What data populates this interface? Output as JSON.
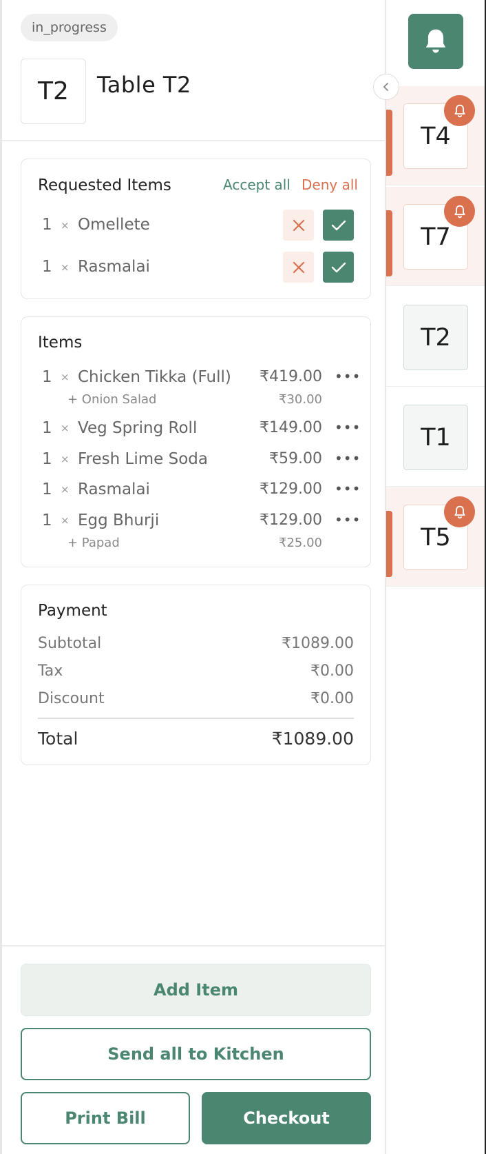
{
  "order": {
    "status": "in_progress",
    "table_code": "T2",
    "table_title": "Table T2"
  },
  "requested": {
    "title": "Requested Items",
    "accept_all": "Accept all",
    "deny_all": "Deny all",
    "items": [
      {
        "qty": "1",
        "times": "×",
        "name": "Omellete"
      },
      {
        "qty": "1",
        "times": "×",
        "name": "Rasmalai"
      }
    ]
  },
  "items": {
    "title": "Items",
    "rows": [
      {
        "qty": "1",
        "times": "×",
        "name": "Chicken Tikka (Full)",
        "price": "₹419.00",
        "more": "•••",
        "modifier": "+ Onion Salad",
        "modifier_price": "₹30.00"
      },
      {
        "qty": "1",
        "times": "×",
        "name": "Veg Spring Roll",
        "price": "₹149.00",
        "more": "•••"
      },
      {
        "qty": "1",
        "times": "×",
        "name": "Fresh Lime Soda",
        "price": "₹59.00",
        "more": "•••"
      },
      {
        "qty": "1",
        "times": "×",
        "name": "Rasmalai",
        "price": "₹129.00",
        "more": "•••"
      },
      {
        "qty": "1",
        "times": "×",
        "name": "Egg Bhurji",
        "price": "₹129.00",
        "more": "•••",
        "modifier": "+ Papad",
        "modifier_price": "₹25.00"
      }
    ]
  },
  "payment": {
    "title": "Payment",
    "subtotal_label": "Subtotal",
    "subtotal": "₹1089.00",
    "tax_label": "Tax",
    "tax": "₹0.00",
    "discount_label": "Discount",
    "discount": "₹0.00",
    "total_label": "Total",
    "total": "₹1089.00"
  },
  "actions": {
    "add_item": "Add Item",
    "send_kitchen": "Send all to Kitchen",
    "print_bill": "Print Bill",
    "checkout": "Checkout"
  },
  "tables": [
    {
      "code": "T4",
      "state": "alert",
      "icon": "bell-icon"
    },
    {
      "code": "T7",
      "state": "alert",
      "icon": "bell-icon"
    },
    {
      "code": "T2",
      "state": "idle"
    },
    {
      "code": "T1",
      "state": "idle"
    },
    {
      "code": "T5",
      "state": "alert",
      "icon": "bell-icon"
    }
  ],
  "colors": {
    "primary": "#4a8670",
    "danger": "#d9714f",
    "danger_bg": "#fbeee8",
    "alert_tile_bg": "#fbf1ef"
  },
  "icons": {
    "main_notifications": "bell-icon",
    "collapse": "chevron-left-icon",
    "deny": "close-icon",
    "accept": "check-icon",
    "more": "more-horizontal-icon"
  }
}
